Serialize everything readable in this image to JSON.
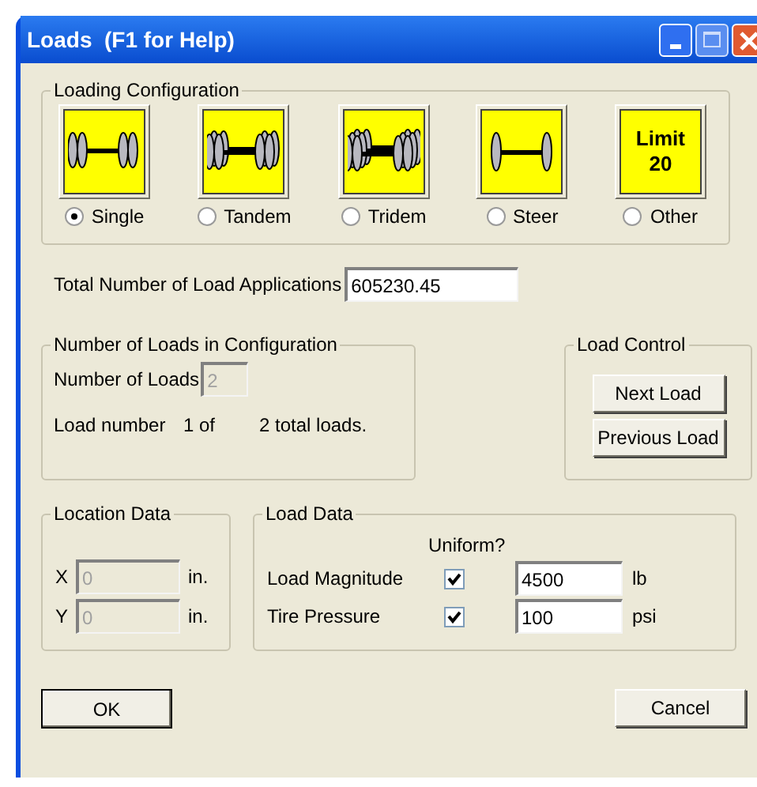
{
  "window": {
    "title": "Loads  (F1 for Help)"
  },
  "loading_configuration": {
    "title": "Loading Configuration",
    "options": [
      {
        "kind": "single",
        "label": "Single",
        "selected": true
      },
      {
        "kind": "tandem",
        "label": "Tandem",
        "selected": false
      },
      {
        "kind": "tridem",
        "label": "Tridem",
        "selected": false
      },
      {
        "kind": "steer",
        "label": "Steer",
        "selected": false
      },
      {
        "kind": "limit",
        "icon_text": [
          "Limit",
          "20"
        ],
        "label": "Other",
        "selected": false
      }
    ]
  },
  "total_applications": {
    "label": "Total Number of Load Applications",
    "value": "605230.45"
  },
  "number_of_loads": {
    "title": "Number of Loads in Configuration",
    "label": "Number of Loads",
    "value": "2",
    "disabled": true,
    "load_number_label": "Load number",
    "current": "1 of",
    "total": "2 total loads."
  },
  "load_control": {
    "title": "Load Control",
    "buttons": [
      "Next Load",
      "Previous Load"
    ]
  },
  "location_data": {
    "title": "Location Data",
    "fields": [
      {
        "label": "X",
        "value": "0",
        "unit": "in.",
        "disabled": true
      },
      {
        "label": "Y",
        "value": "0",
        "unit": "in.",
        "disabled": true
      }
    ]
  },
  "load_data": {
    "title": "Load Data",
    "uniform_header": "Uniform?",
    "rows": [
      {
        "label": "Load Magnitude",
        "uniform": true,
        "value": "4500",
        "unit": "lb"
      },
      {
        "label": "Tire Pressure",
        "uniform": true,
        "value": "100",
        "unit": "psi"
      }
    ]
  },
  "buttons": [
    "OK",
    "Cancel"
  ]
}
